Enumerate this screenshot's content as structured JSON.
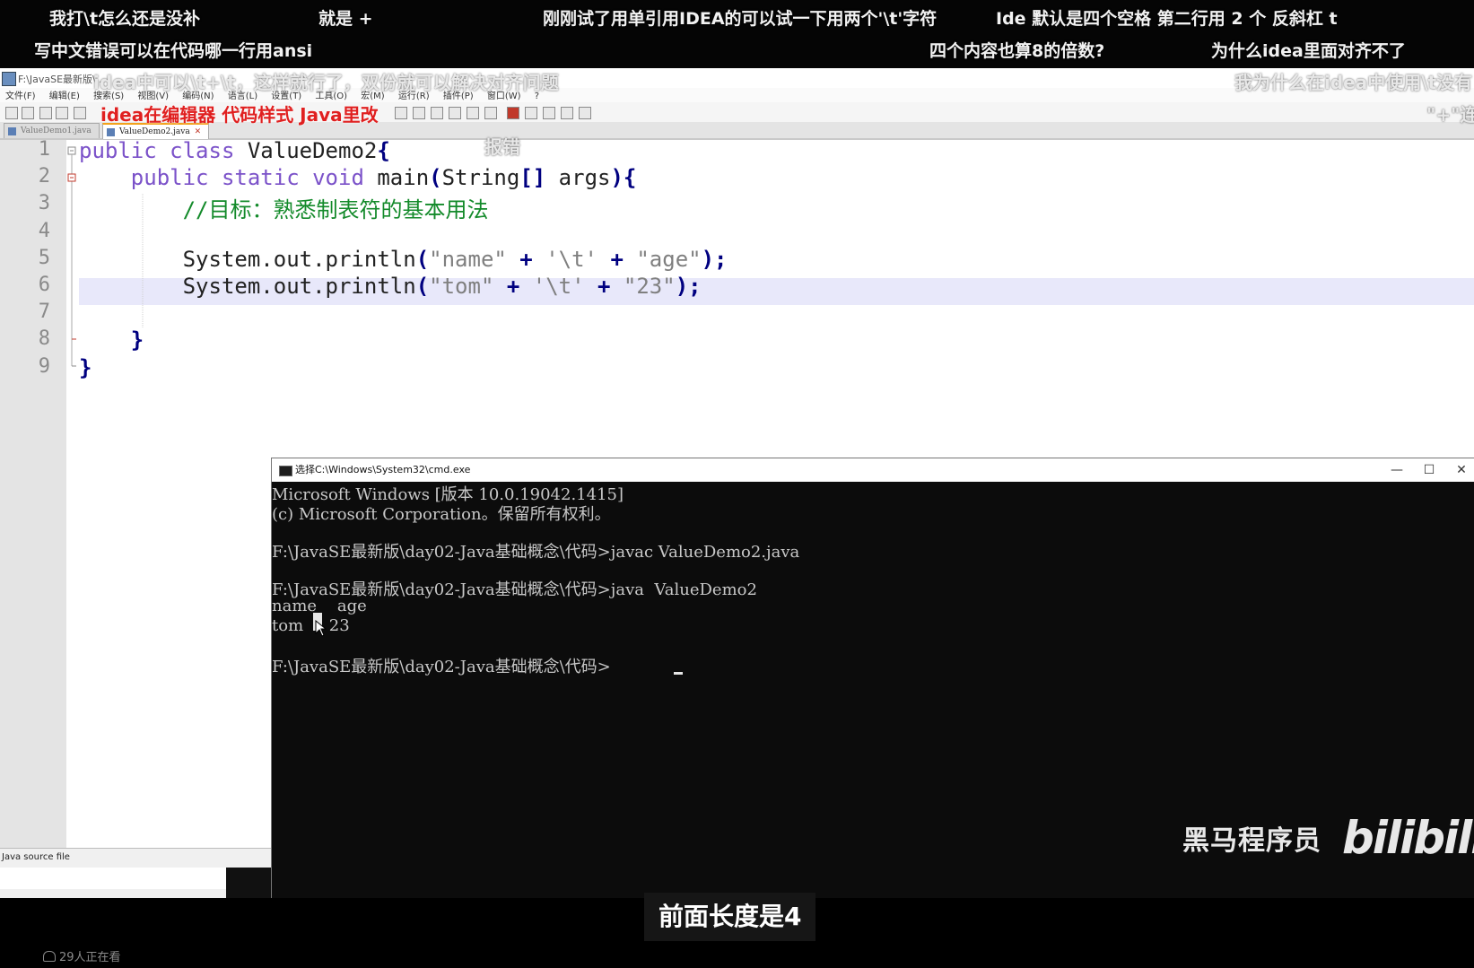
{
  "danmaku": {
    "top_row": [
      "我打\\t怎么还是没补",
      "就是 +",
      "刚刚试了用单引用IDEA的可以试一下用两个'\\t'字符",
      "Ide 默认是四个空格 第二行用 2 个 反斜杠 t"
    ],
    "second_row": [
      "写中文错误可以在代码哪一行用ansi",
      "四个内容也算8的倍数?",
      "为什么idea里面对齐不了"
    ],
    "overlay": {
      "title_bar_comment": "idea中可以\\t+\\t，这样就行了，双份就可以解决对齐问题",
      "right_comment": "我为什么在idea中使用\\t没有",
      "red_comment": "idea在编辑器 代码样式 Java里改",
      "toolbar_right_comment": "\"+\"连",
      "code_comment": "报错"
    }
  },
  "editor": {
    "title": "F:\\JavaSE最新版\\...",
    "menu": [
      "文件(F)",
      "编辑(E)",
      "搜索(S)",
      "视图(V)",
      "编码(N)",
      "语言(L)",
      "设置(T)",
      "工具(O)",
      "宏(M)",
      "运行(R)",
      "插件(P)",
      "窗口(W)",
      "?"
    ],
    "tabs": [
      {
        "label": "ValueDemo1.java",
        "active": false
      },
      {
        "label": "ValueDemo2.java",
        "active": true
      }
    ],
    "line_numbers": [
      "1",
      "2",
      "3",
      "4",
      "5",
      "6",
      "7",
      "8",
      "9"
    ],
    "code": {
      "l1_kw1": "public",
      "l1_kw2": "class",
      "l1_rest": " ValueDemo2",
      "l1_brace": "{",
      "l2_kw1": "public",
      "l2_kw2": "static",
      "l2_kw3": "void",
      "l2_rest": " main",
      "l2_paren": "(",
      "l2_type": "String",
      "l2_arr": "[]",
      "l2_arg": " args",
      "l2_close": "){",
      "l3_comment": "//目标：熟悉制表符的基本用法",
      "l5_call": "System.out.println",
      "l5_open": "(",
      "l5_s1": "\"name\"",
      "l5_plus1": " + ",
      "l5_s2": "'\\t'",
      "l5_plus2": " + ",
      "l5_s3": "\"age\"",
      "l5_close": ");",
      "l6_call": "System.out.println",
      "l6_open": "(",
      "l6_s1": "\"tom\"",
      "l6_plus1": " + ",
      "l6_s2": "'\\t'",
      "l6_plus2": " + ",
      "l6_s3": "\"23\"",
      "l6_close": ");",
      "l8_brace": "}",
      "l9_brace": "}"
    },
    "status": "Java source file"
  },
  "cmd": {
    "title": "选择C:\\Windows\\System32\\cmd.exe",
    "lines": [
      "Microsoft Windows [版本 10.0.19042.1415]",
      "(c) Microsoft Corporation。保留所有权利。",
      "",
      "F:\\JavaSE最新版\\day02-Java基础概念\\代码>javac ValueDemo2.java",
      "",
      "F:\\JavaSE最新版\\day02-Java基础概念\\代码>java  ValueDemo2",
      "name    age",
      "tom     23",
      "",
      "F:\\JavaSE最新版\\day02-Java基础概念\\代码>"
    ],
    "buttons": {
      "minimize": "—",
      "maximize": "☐",
      "close": "✕"
    }
  },
  "watermark": {
    "brand": "黑马程序员",
    "bilibili": "bilibili"
  },
  "subtitle": "前面长度是4",
  "viewers": "29人正在看",
  "colors": {
    "keyword": "#7b52c9",
    "keyword_type": "#1f3b9e",
    "string": "#7f7f7f",
    "operator": "#000080",
    "comment": "#138a2a",
    "highlight_line": "#e8e8fa",
    "overlay_red": "#e02020"
  }
}
